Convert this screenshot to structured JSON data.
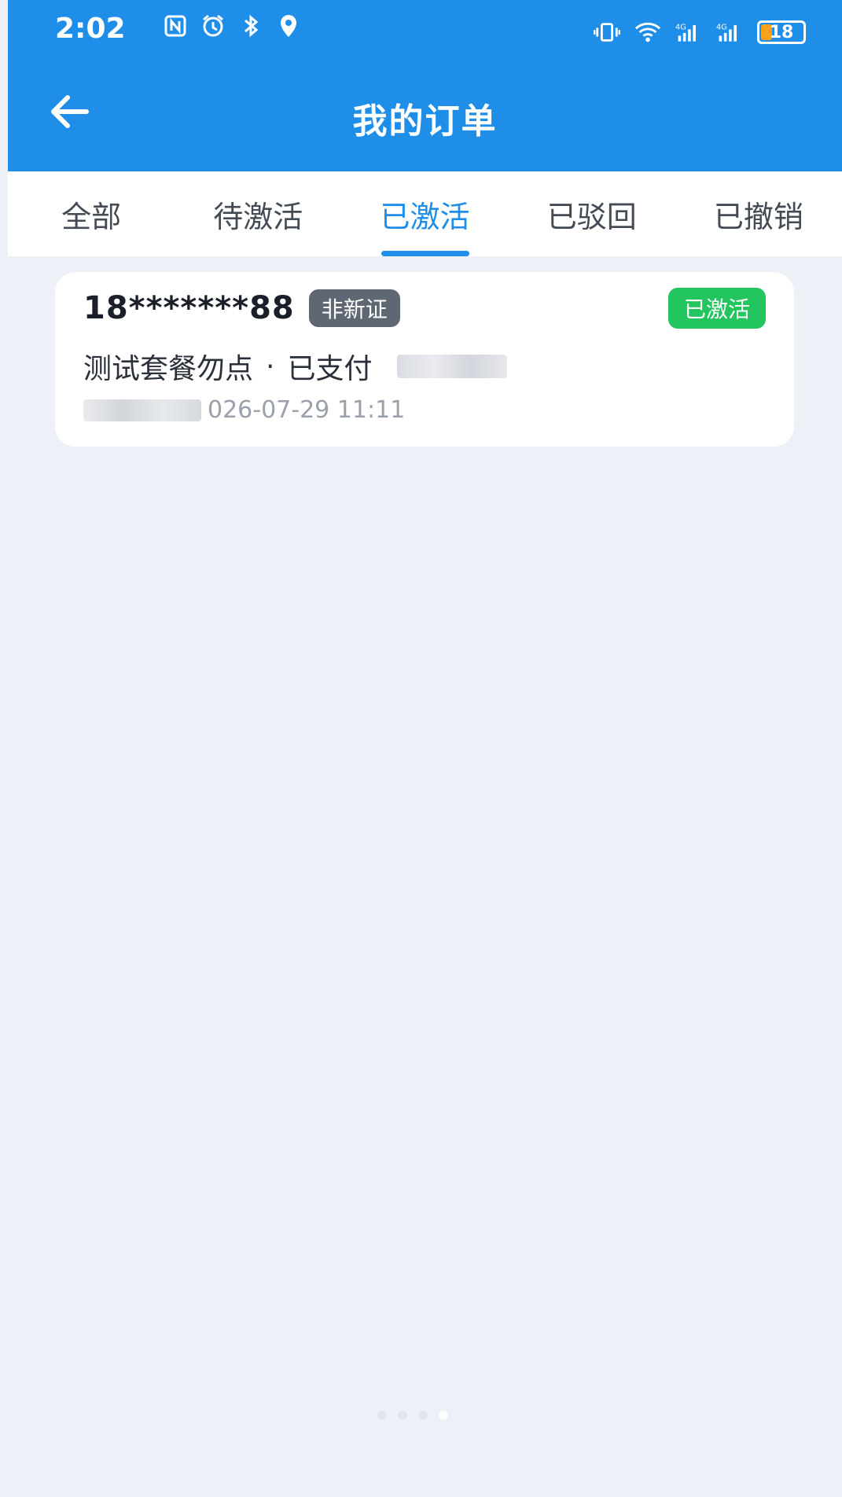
{
  "status_bar": {
    "time": "2:02",
    "battery_level": "18",
    "left_icons": [
      "nfc-icon",
      "alarm-icon",
      "bluetooth-icon",
      "location-icon"
    ],
    "right_icons": [
      "vibrate-icon",
      "wifi-icon",
      "signal-4g-icon",
      "signal-4g-icon"
    ]
  },
  "header": {
    "title": "我的订单"
  },
  "tabs": [
    {
      "label": "全部"
    },
    {
      "label": "待激活"
    },
    {
      "label": "已激活"
    },
    {
      "label": "已驳回"
    },
    {
      "label": "已撤销"
    }
  ],
  "active_tab_index": 2,
  "order": {
    "phone": "18*******88",
    "tag": "非新证",
    "status": "已激活",
    "package": "测试套餐勿点",
    "payment_status": "已支付",
    "separator": "·",
    "date_fragment": "026-07-29 11:11"
  },
  "colors": {
    "primary": "#1f8ee8",
    "success": "#22c55e",
    "tag_grey": "#5f6773",
    "background": "#edf0f6"
  },
  "pagination": {
    "count": 4,
    "active_index": 3
  }
}
